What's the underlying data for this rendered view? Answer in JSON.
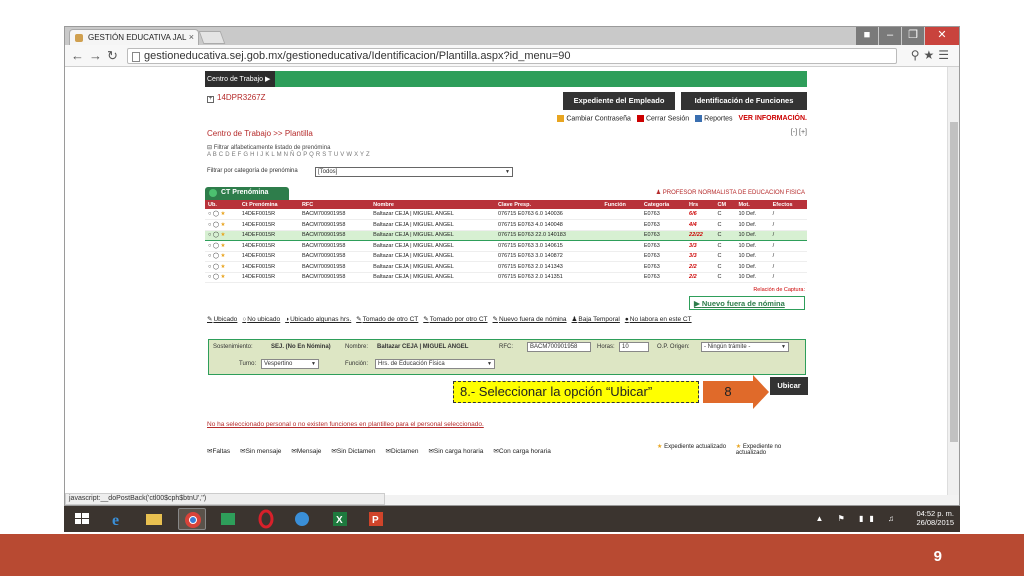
{
  "browser": {
    "tab_title": "GESTIÓN EDUCATIVA JAL",
    "tab_close": "×",
    "url": "gestioneducativa.sej.gob.mx/gestioneducativa/Identificacion/Plantilla.aspx?id_menu=90",
    "status": "javascript:__doPostBack('ctl00$cph$btnU','')"
  },
  "header": {
    "ct_label": "Centro de Trabajo",
    "ct_code": "14DPR3267Z",
    "expediente_button": "Expediente del Empleado",
    "identificacion_button": "Identificación de Funciones",
    "links": {
      "cambiar": "Cambiar Contraseña",
      "cerrar": "Cerrar Sesión",
      "reportes": "Reportes",
      "ver_info": "VER INFORMACIÓN."
    }
  },
  "breadcrumb": "Centro de Trabajo >> Plantilla",
  "pager": "[-] [+]",
  "filters": {
    "alpha_label": "Filtrar alfabeticamente listado de prenómina",
    "alpha_letters": "A B C D E F G H I J K L M N Ñ O P Q R S T U V W X Y Z",
    "category_label": "Filtrar por categoría de prenómina",
    "category_value": "[Todos]"
  },
  "grid": {
    "tab_label": "CT Prenómina",
    "profesor": "PROFESOR NORMALISTA DE EDUCACION FISICA",
    "columns": [
      "Ub.",
      "Ct Prenómina",
      "RFC",
      "Nombre",
      "Clave Presp.",
      "Función",
      "Categoría",
      "Hrs",
      "CM",
      "Mot.",
      "Efectos"
    ],
    "rows": [
      {
        "ct": "14DEF0015R",
        "rfc": "BACM700901958",
        "nombre": "Baltazar CEJA | MIGUEL ANGEL",
        "clave": "076715 E0763 6.0 140036",
        "funcion": "",
        "cat": "E0763",
        "hrs": "6/6",
        "cm": "C",
        "mot": "10 Def.",
        "ef": "/"
      },
      {
        "ct": "14DEF0015R",
        "rfc": "BACM700901958",
        "nombre": "Baltazar CEJA | MIGUEL ANGEL",
        "clave": "076715 E0763 4.0 140048",
        "funcion": "",
        "cat": "E0763",
        "hrs": "4/4",
        "cm": "C",
        "mot": "10 Def.",
        "ef": "/"
      },
      {
        "ct": "14DEF0015R",
        "rfc": "BACM700901958",
        "nombre": "Baltazar CEJA | MIGUEL ANGEL",
        "clave": "076715 E0763 22.0 140183",
        "funcion": "",
        "cat": "E0763",
        "hrs": "22/22",
        "cm": "C",
        "mot": "10 Def.",
        "ef": "/"
      },
      {
        "ct": "14DEF0015R",
        "rfc": "BACM700901958",
        "nombre": "Baltazar CEJA | MIGUEL ANGEL",
        "clave": "076715 E0763 3.0 140615",
        "funcion": "",
        "cat": "E0763",
        "hrs": "3/3",
        "cm": "C",
        "mot": "10 Def.",
        "ef": "/"
      },
      {
        "ct": "14DEF0015R",
        "rfc": "BACM700901958",
        "nombre": "Baltazar CEJA | MIGUEL ANGEL",
        "clave": "076715 E0763 3.0 140872",
        "funcion": "",
        "cat": "E0763",
        "hrs": "3/3",
        "cm": "C",
        "mot": "10 Def.",
        "ef": "/"
      },
      {
        "ct": "14DEF0015R",
        "rfc": "BACM700901958",
        "nombre": "Baltazar CEJA | MIGUEL ANGEL",
        "clave": "076715 E0763 2.0 141343",
        "funcion": "",
        "cat": "E0763",
        "hrs": "2/2",
        "cm": "C",
        "mot": "10 Def.",
        "ef": "/"
      },
      {
        "ct": "14DEF0015R",
        "rfc": "BACM700901958",
        "nombre": "Baltazar CEJA | MIGUEL ANGEL",
        "clave": "076715 E0763 2.0 141351",
        "funcion": "",
        "cat": "E0763",
        "hrs": "2/2",
        "cm": "C",
        "mot": "10 Def.",
        "ef": "/"
      }
    ],
    "selected_row": 2,
    "relacion": "Relación de Captura:",
    "nuevo_fuera": "Nuevo fuera de nómina"
  },
  "legend1": [
    "Ubicado",
    "No ubicado",
    "Ubicado algunas hrs.",
    "Tomado de otro CT",
    "Tomado por otro CT",
    "Nuevo fuera de nómina",
    "Baja Temporal",
    "No labora en este CT"
  ],
  "form": {
    "sostenimiento_label": "Sostenimiento:",
    "sostenimiento_value": "SEJ. (No En Nómina)",
    "nombre_label": "Nombre:",
    "nombre_value": "Baltazar CEJA | MIGUEL ANGEL",
    "rfc_label": "RFC:",
    "rfc_value": "BACM700901958",
    "horas_label": "Horas:",
    "horas_value": "10",
    "origen_label": "O.P. Origen:",
    "origen_value": "- Ningún trámite -",
    "turno_label": "Turno:",
    "turno_value": "Vespertino",
    "funcion_label": "Función:",
    "funcion_value": "Hrs. de Educación Física"
  },
  "callout": {
    "text": "8.- Seleccionar la opción “Ubicar”",
    "number": "8",
    "ubicar_button": "Ubicar"
  },
  "warning": "No ha seleccionado personal o no existen funciones en plantilleo para el personal seleccionado.",
  "legend2": [
    "Faltas",
    "Sin mensaje",
    "Mensaje",
    "Sin Dictamen",
    "Dictamen",
    "Sin carga horaria",
    "Con carga horaria"
  ],
  "legend3": {
    "actualizado": "Expediente actualizado",
    "no_actualizado": "Expediente no actualizado"
  },
  "taskbar": {
    "time": "04:52 p. m.",
    "date": "26/08/2015"
  },
  "slide_number": "9",
  "colors": {
    "green": "#2e9e5a",
    "red_header": "#b8323a",
    "callout_yellow": "#ffff00",
    "arrow_orange": "#e06a2a",
    "footer": "#b84a32"
  }
}
